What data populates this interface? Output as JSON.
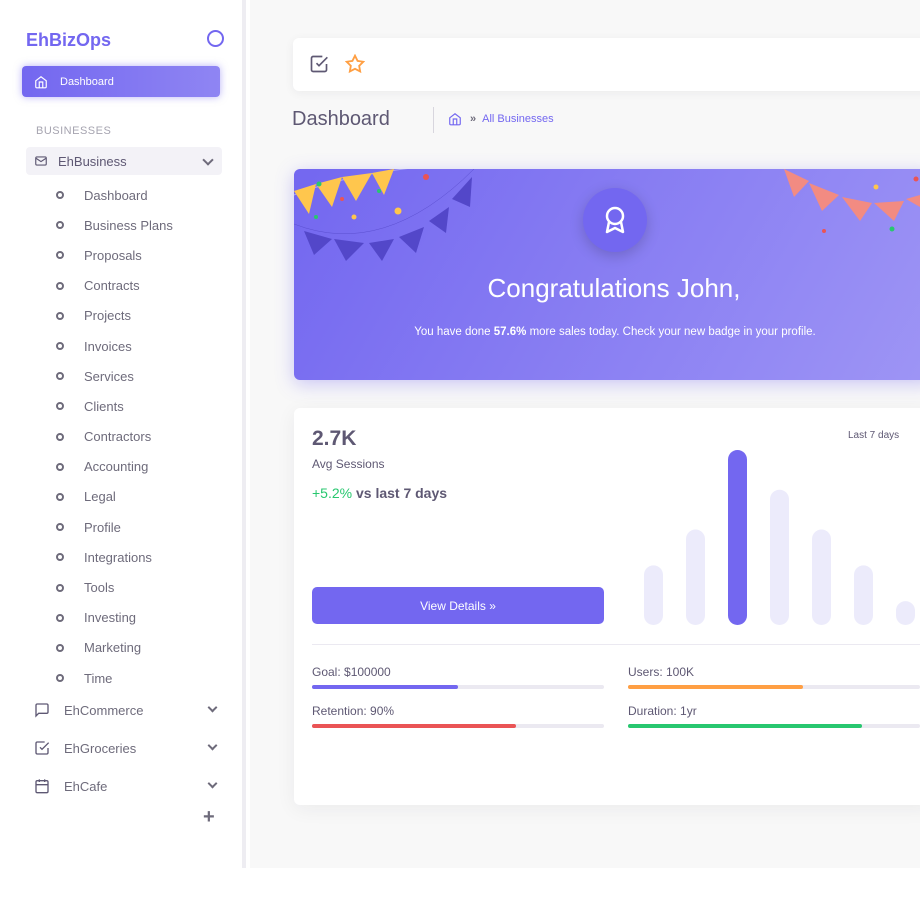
{
  "app": {
    "brand": "EhBizOps"
  },
  "sidebar": {
    "active_item": "Dashboard",
    "section_title": "BUSINESSES",
    "open_group": "EhBusiness",
    "sub_items": [
      "Dashboard",
      "Business Plans",
      "Proposals",
      "Contracts",
      "Projects",
      "Invoices",
      "Services",
      "Clients",
      "Contractors",
      "Accounting",
      "Legal",
      "Profile",
      "Integrations",
      "Tools",
      "Investing",
      "Marketing",
      "Time"
    ],
    "groups": [
      "EhCommerce",
      "EhGroceries",
      "EhCafe"
    ],
    "add_symbol": "+"
  },
  "header": {
    "page_title": "Dashboard",
    "breadcrumb_sep": "»",
    "breadcrumb_current": "All Businesses"
  },
  "congrats": {
    "title": "Congratulations John,",
    "text_before": "You have done ",
    "text_bold": "57.6%",
    "text_after": " more sales today. Check your new badge in your profile."
  },
  "stats": {
    "value": "2.7K",
    "label": "Avg Sessions",
    "growth_value": "+5.2%",
    "growth_text": " vs last 7 days",
    "range": "Last 7 days",
    "button": "View Details »",
    "goals": [
      {
        "label": "Goal: $100000",
        "fraction": 0.5,
        "color": "#7367f0"
      },
      {
        "label": "Users: 100K",
        "fraction": 0.6,
        "color": "#ff9f43"
      },
      {
        "label": "Retention: 90%",
        "fraction": 0.7,
        "color": "#ea5455"
      },
      {
        "label": "Duration: 1yr",
        "fraction": 0.8,
        "color": "#28c76f"
      }
    ]
  },
  "chart_data": {
    "type": "bar",
    "values": [
      75,
      120,
      220,
      170,
      120,
      75,
      30
    ],
    "highlight_index": 2,
    "colors": {
      "bar": "#ecebfb",
      "highlight": "#7367f0"
    }
  }
}
